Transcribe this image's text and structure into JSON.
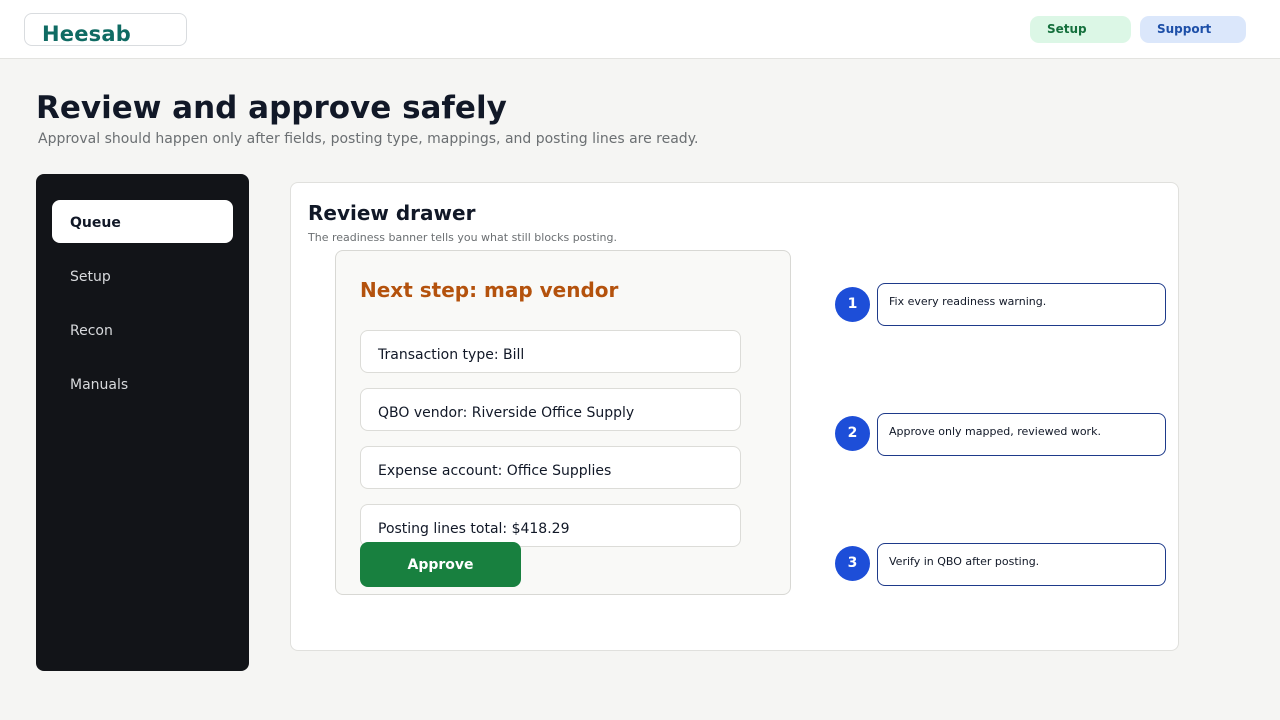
{
  "header": {
    "brand": "Heesab",
    "setup_label": "Setup",
    "support_label": "Support"
  },
  "page": {
    "title": "Review and approve safely",
    "subtitle": "Approval should happen only after fields, posting type, mappings, and posting lines are ready."
  },
  "sidebar": {
    "items": [
      {
        "label": "Queue",
        "active": true
      },
      {
        "label": "Setup",
        "active": false
      },
      {
        "label": "Recon",
        "active": false
      },
      {
        "label": "Manuals",
        "active": false
      }
    ]
  },
  "drawer": {
    "title": "Review drawer",
    "subtitle": "The readiness banner tells you what still blocks posting.",
    "banner": "Next step: map vendor",
    "fields": [
      "Transaction type: Bill",
      "QBO vendor: Riverside Office Supply",
      "Expense account: Office Supplies",
      "Posting lines total: $418.29"
    ],
    "approve_label": "Approve"
  },
  "steps": [
    {
      "number": "1",
      "text": "Fix every readiness warning."
    },
    {
      "number": "2",
      "text": "Approve only mapped, reviewed work."
    },
    {
      "number": "3",
      "text": "Verify in QBO after posting."
    }
  ],
  "colors": {
    "brand": "#0f6b63",
    "sidebar_bg": "#121418",
    "banner": "#b4520d",
    "approve": "#18803f",
    "step_accent": "#1d4ed8"
  }
}
